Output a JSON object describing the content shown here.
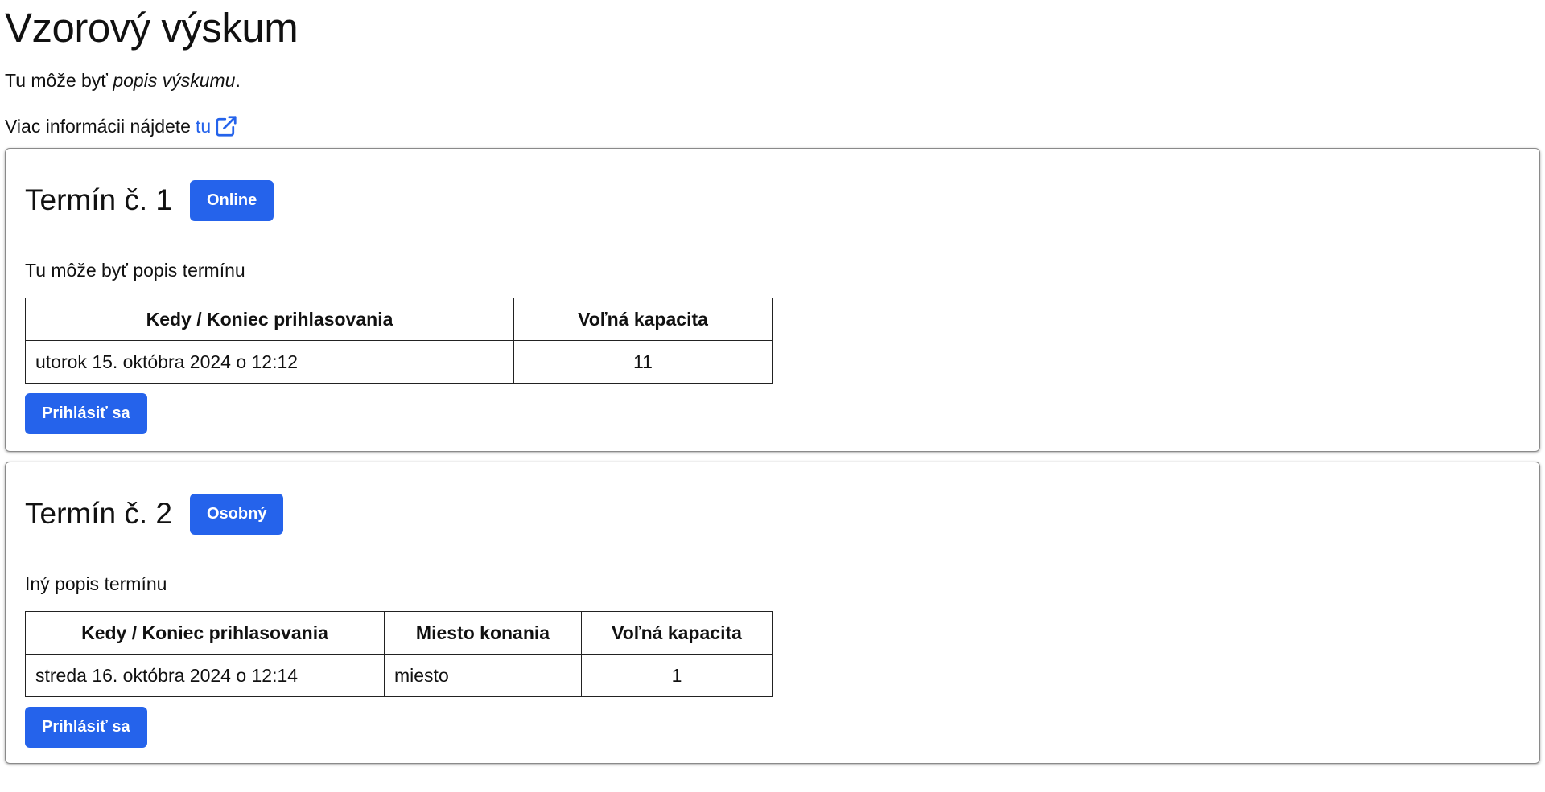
{
  "page": {
    "title": "Vzorový výskum",
    "intro_prefix": "Tu môže byť ",
    "intro_emphasis": "popis výskumu",
    "intro_suffix": ".",
    "more_prefix": "Viac informácii nájdete",
    "more_link": "tu",
    "icons": {
      "external_link": "external-link-icon"
    },
    "accent_color": "#2563eb"
  },
  "slots": [
    {
      "title": "Termín č. 1",
      "badge": "Online",
      "description": "Tu môže byť popis termínu",
      "headers": [
        "Kedy / Koniec prihlasovania",
        "Voľná kapacita"
      ],
      "row": [
        "utorok 15. októbra 2024 o 12:12",
        "11"
      ],
      "button": "Prihlásiť sa"
    },
    {
      "title": "Termín č. 2",
      "badge": "Osobný",
      "description": "Iný popis termínu",
      "headers": [
        "Kedy / Koniec prihlasovania",
        "Miesto konania",
        "Voľná kapacita"
      ],
      "row": [
        "streda 16. októbra 2024 o 12:14",
        "miesto",
        "1"
      ],
      "button": "Prihlásiť sa"
    }
  ]
}
